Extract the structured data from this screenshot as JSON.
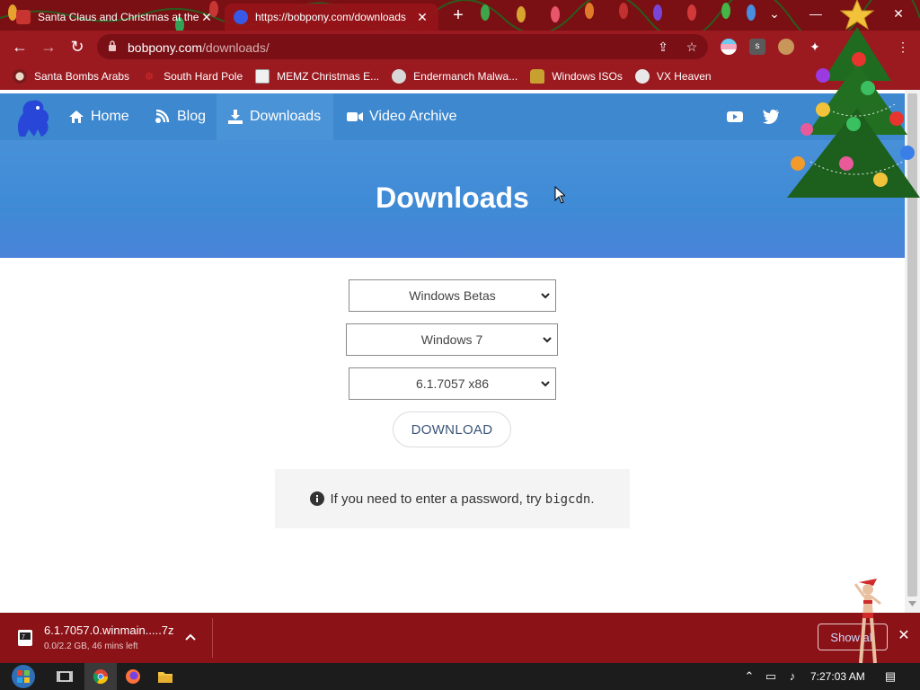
{
  "browser": {
    "tabs": [
      {
        "title": "Santa Claus and Christmas at the",
        "active": false
      },
      {
        "title": "https://bobpony.com/downloads",
        "active": true
      }
    ],
    "new_tab_symbol": "+",
    "address": {
      "domain": "bobpony.com",
      "path": "/downloads/"
    },
    "bookmarks": [
      {
        "label": "Santa Bombs Arabs",
        "icon": "santa-icon"
      },
      {
        "label": "South Hard Pole",
        "icon": "pentagram-icon"
      },
      {
        "label": "MEMZ Christmas E...",
        "icon": "window-icon"
      },
      {
        "label": "Endermanch Malwa...",
        "icon": "raccoon-icon"
      },
      {
        "label": "Windows ISOs",
        "icon": "figure-icon"
      },
      {
        "label": "VX Heaven",
        "icon": "skull-icon"
      }
    ]
  },
  "site": {
    "nav": [
      {
        "label": "Home",
        "icon": "home-icon",
        "active": false
      },
      {
        "label": "Blog",
        "icon": "blog-icon",
        "active": false
      },
      {
        "label": "Downloads",
        "icon": "download-icon",
        "active": true
      },
      {
        "label": "Video Archive",
        "icon": "video-icon",
        "active": false
      }
    ],
    "social": [
      "youtube-icon",
      "twitter-icon"
    ]
  },
  "page": {
    "title": "Downloads",
    "selects": {
      "category": "Windows Betas",
      "version": "Windows 7",
      "build": "6.1.7057 x86"
    },
    "download_label": "DOWNLOAD",
    "note_prefix": "If you need to enter a password, try ",
    "note_code": "bigcdn",
    "note_suffix": "."
  },
  "download_shelf": {
    "file_name": "6.1.7057.0.winmain.....7z",
    "file_status": "0.0/2.2 GB, 46 mins left",
    "show_all_label": "Show all"
  },
  "taskbar": {
    "clock": "7:27:03 AM"
  },
  "colors": {
    "browser_frame": "#9a1a20",
    "site_nav": "#3d88cf",
    "hero": "#4891d8",
    "shelf": "#8b1217"
  }
}
